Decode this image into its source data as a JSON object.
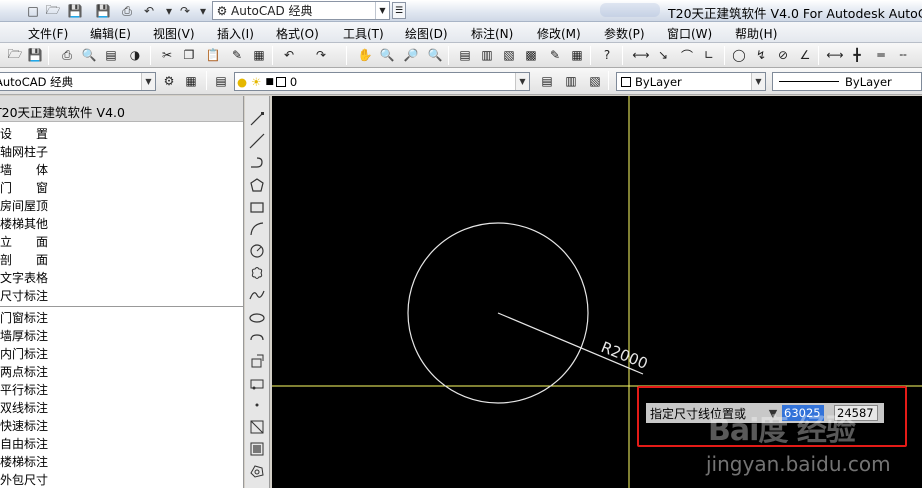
{
  "window": {
    "title": "T20天正建筑软件 V4.0 For Autodesk AutoCAD",
    "workspace": "AutoCAD 经典"
  },
  "menus": [
    "文件(F)",
    "编辑(E)",
    "视图(V)",
    "插入(I)",
    "格式(O)",
    "工具(T)",
    "绘图(D)",
    "标注(N)",
    "修改(M)",
    "参数(P)",
    "窗口(W)",
    "帮助(H)"
  ],
  "toolbar2": {
    "workspace_combo": "AutoCAD 经典",
    "layer_combo": "0",
    "color_combo": "ByLayer",
    "linetype_combo": "ByLayer"
  },
  "leftpanel": {
    "title": "T20天正建筑软件 V4.0",
    "groups": [
      "设　　置",
      "轴网柱子",
      "墙　　体",
      "门　　窗",
      "房间屋顶",
      "楼梯其他",
      "立　　面",
      "剖　　面",
      "文字表格",
      "尺寸标注"
    ],
    "subitems": [
      "门窗标注",
      "墙厚标注",
      "内门标注",
      "两点标注",
      "平行标注",
      "双线标注",
      "快速标注",
      "自由标注",
      "楼梯标注",
      "外包尺寸"
    ]
  },
  "canvas": {
    "radius_label": "R2000",
    "command_prompt": "指定尺寸线位置或",
    "coord_x": "63025",
    "coord_y": "24587",
    "watermark_logo": "Bai度 经验",
    "watermark_url": "jingyan.baidu.com",
    "colors": {
      "background": "#000000",
      "crosshair": "#ffff66",
      "geometry": "#e6e6e6",
      "highlight_box": "#e41b17"
    }
  }
}
